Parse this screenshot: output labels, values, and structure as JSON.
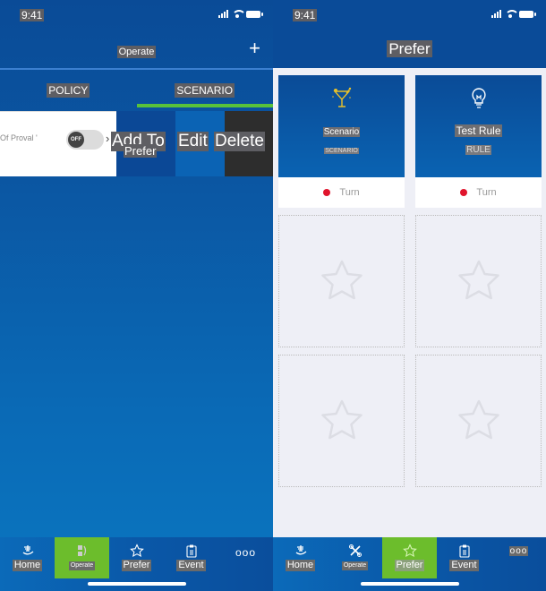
{
  "status_bar": {
    "time": "9:41"
  },
  "left": {
    "title": "Operate",
    "add_icon": "plus-icon",
    "tabs": [
      {
        "label": "POLICY",
        "active": false
      },
      {
        "label": "SCENARIO",
        "active": true
      }
    ],
    "row": {
      "name": "Of Proval '",
      "toggle_label": "OFF",
      "toggle_on": false,
      "actions": {
        "add_line1": "Add To",
        "add_line2": "Prefer",
        "edit": "Edit",
        "delete": "Delete"
      }
    }
  },
  "right": {
    "title": "Prefer",
    "favorites": [
      {
        "name": "Scenario",
        "type": "SCENARIO",
        "icon": "cocktail-icon",
        "status": "Turn",
        "status_color": "#e0142c"
      },
      {
        "name": "Test Rule",
        "type": "RULE",
        "icon": "lightbulb-icon",
        "status": "Turn",
        "status_color": "#e0142c"
      }
    ],
    "empty_slots": 4
  },
  "tabbar_left": [
    {
      "label": "Home",
      "icon": "home-icon",
      "active": false
    },
    {
      "label": "Operate",
      "icon": "operate-icon",
      "active": true
    },
    {
      "label": "Prefer",
      "icon": "star-icon",
      "active": false
    },
    {
      "label": "Event",
      "icon": "clipboard-icon",
      "active": false
    },
    {
      "label": "ooo",
      "icon": "more-icon",
      "active": false
    }
  ],
  "tabbar_right": [
    {
      "label": "Home",
      "icon": "home-icon",
      "active": false
    },
    {
      "label": "Operate",
      "icon": "tools-icon",
      "active": false
    },
    {
      "label": "Prefer",
      "icon": "star-icon",
      "active": true
    },
    {
      "label": "Event",
      "icon": "clipboard-icon",
      "active": false
    },
    {
      "label": "ooo",
      "icon": "more-icon",
      "active": false
    }
  ],
  "colors": {
    "brand_blue": "#0a4b98",
    "accent_green": "#6cbd2c",
    "status_red": "#e0142c"
  }
}
